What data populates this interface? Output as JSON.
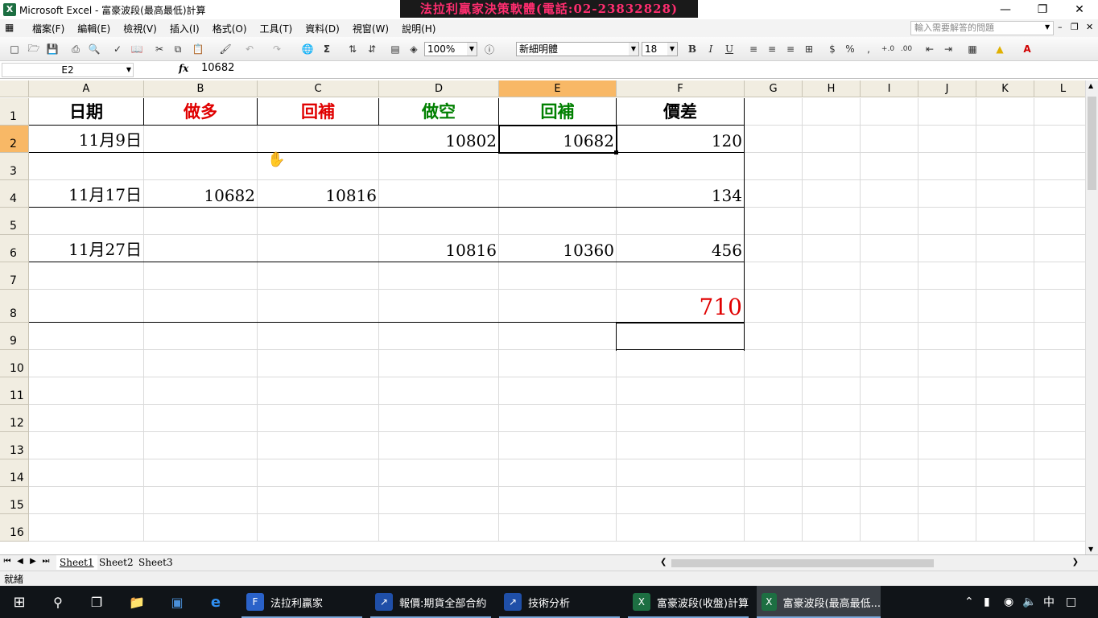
{
  "window": {
    "title": "Microsoft Excel - 富豪波段(最高最低)計算",
    "banner": "法拉利贏家決策軟體(電話:02-23832828)"
  },
  "menu": [
    "檔案(F)",
    "編輯(E)",
    "檢視(V)",
    "插入(I)",
    "格式(O)",
    "工具(T)",
    "資料(D)",
    "視窗(W)",
    "說明(H)"
  ],
  "help_placeholder": "輸入需要解答的問題",
  "toolbar": {
    "zoom": "100%",
    "font": "新細明體",
    "size": "18"
  },
  "formula": {
    "namebox": "E2",
    "fx": "fx",
    "value": "10682"
  },
  "columns": [
    "A",
    "B",
    "C",
    "D",
    "E",
    "F",
    "G",
    "H",
    "I",
    "J",
    "K",
    "L"
  ],
  "rows": [
    "1",
    "2",
    "3",
    "4",
    "5",
    "6",
    "7",
    "8",
    "9",
    "10",
    "11",
    "12",
    "13",
    "14",
    "15",
    "16"
  ],
  "cells": {
    "A1": {
      "text": "日期",
      "color": "#000000"
    },
    "B1": {
      "text": "做多",
      "color": "#e00000"
    },
    "C1": {
      "text": "回補",
      "color": "#e00000"
    },
    "D1": {
      "text": "做空",
      "color": "#008000"
    },
    "E1": {
      "text": "回補",
      "color": "#008000"
    },
    "F1": {
      "text": "價差",
      "color": "#000000"
    },
    "A2": "11月9日",
    "D2": "10802",
    "E2": "10682",
    "F2": "120",
    "A4": "11月17日",
    "B4": "10682",
    "C4": "10816",
    "F4": "134",
    "A6": "11月27日",
    "D6": "10816",
    "E6": "10360",
    "F6": "456",
    "F8": {
      "text": "710",
      "color": "#e00000"
    }
  },
  "sheets": [
    "Sheet1",
    "Sheet2",
    "Sheet3"
  ],
  "status": "就緒",
  "taskbar": {
    "items": [
      "法拉利贏家",
      "報價:期貨全部合約",
      "技術分析",
      "富豪波段(收盤)計算",
      "富豪波段(最高最低..."
    ],
    "ime": "中"
  }
}
